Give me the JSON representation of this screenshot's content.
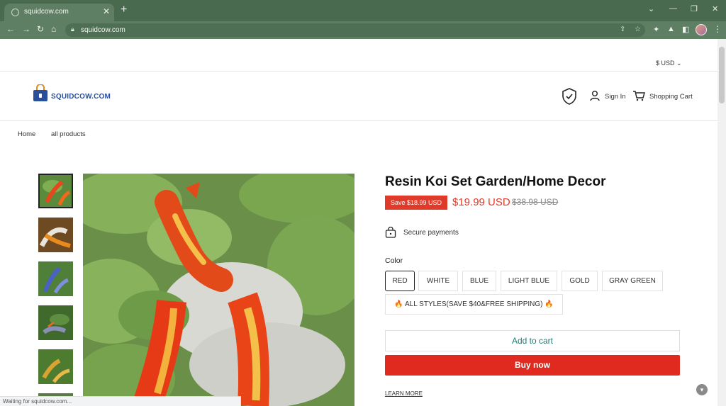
{
  "browser": {
    "tab_title": "squidcow.com",
    "new_tab": "+",
    "close_tab": "✕",
    "url": "squidcow.com",
    "window_controls": [
      "⌄",
      "—",
      "❐",
      "✕"
    ]
  },
  "header": {
    "currency": "$ USD",
    "logo_text": "SQUIDCOW.COM",
    "sign_in": "Sign In",
    "cart": "Shopping Cart"
  },
  "breadcrumb": [
    "Home",
    "all products"
  ],
  "product": {
    "title": "Resin Koi Set Garden/Home Decor",
    "save_badge": "Save $18.99 USD",
    "price": "$19.99 USD",
    "compare_price": "$38.98 USD",
    "secure_payments": "Secure payments",
    "color_label": "Color",
    "color_options": [
      "RED",
      "WHITE",
      "BLUE",
      "LIGHT BLUE",
      "GOLD",
      "GRAY GREEN",
      "🔥 ALL STYLES(SAVE $40&FREE SHIPPING) 🔥"
    ],
    "selected_color": "RED",
    "add_to_cart": "Add to cart",
    "buy_now": "Buy now",
    "learn_more": "LEARN MORE"
  },
  "status_bar": "Waiting for squidcow.com...",
  "colors": {
    "chrome_dark": "#4a6a50",
    "chrome_light": "#5f7f64",
    "accent_red": "#e03a2a",
    "add_cart_text": "#1a7f7a",
    "logo_blue": "#2a4f9a"
  },
  "icons": {
    "back": "arrow-left-icon",
    "forward": "arrow-right-icon",
    "reload": "reload-icon",
    "home": "home-icon",
    "lock": "lock-icon",
    "shield": "shield-check-icon",
    "user": "user-icon",
    "cart": "cart-icon",
    "secure": "secure-bag-icon"
  }
}
